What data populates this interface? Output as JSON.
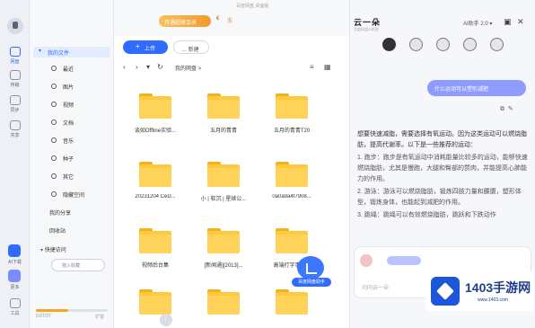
{
  "rail": {
    "items": [
      {
        "label": "网盘"
      },
      {
        "label": "传输"
      },
      {
        "label": "同步"
      },
      {
        "label": "共享"
      }
    ],
    "bottom": [
      {
        "label": "AI下载"
      },
      {
        "label": "更多"
      },
      {
        "label": "工具"
      }
    ]
  },
  "nav": {
    "header": "我的文件",
    "items": [
      {
        "label": "最近",
        "icon": "clock-icon"
      },
      {
        "label": "图片",
        "icon": "image-icon"
      },
      {
        "label": "视频",
        "icon": "play-icon"
      },
      {
        "label": "文档",
        "icon": "doc-icon"
      },
      {
        "label": "音乐",
        "icon": "headphones-icon"
      },
      {
        "label": "种子",
        "icon": "bt-icon"
      },
      {
        "label": "其它",
        "icon": "more-icon"
      },
      {
        "label": "隐藏空间",
        "icon": "lock-icon"
      }
    ],
    "share": "我的分享",
    "recycle": "回收站",
    "quick": "快捷访问",
    "user_placeholder": "拖入收藏",
    "storage": {
      "text": "0.6T/2T",
      "sub": "扩容",
      "used_fraction": 0.45
    }
  },
  "topbar": {
    "vip": "开通超级会员",
    "mini1": "€",
    "mini2": "Ⓢ",
    "dim": "百度网盘 桌面版"
  },
  "toolbar": {
    "upload": "上传",
    "new": "… 新建"
  },
  "path": {
    "crumb": "我的网盘 >"
  },
  "files": [
    {
      "name": "谈如Offline实验..."
    },
    {
      "name": "五月的青青"
    },
    {
      "name": "五月的青青T20"
    },
    {
      "name": "20231204 CeD..."
    },
    {
      "name": "小 | 软沉 | 星续公..."
    },
    {
      "name": "0a0a9a4f7908..."
    },
    {
      "name": "视频后台集"
    },
    {
      "name": "[新闻通][2013]..."
    },
    {
      "name": "高端打字事件..."
    },
    {
      "name": ""
    },
    {
      "name": ""
    },
    {
      "name": ""
    }
  ],
  "float_cloud": {
    "label": "百度网盘助手"
  },
  "ai": {
    "brand": "云一朵",
    "sub": "百度网盘AI助理",
    "user": "AI助手 2.0",
    "avatars": [
      "",
      "",
      "",
      "",
      ""
    ],
    "question": "什么运动可以塑形减肥",
    "answer": [
      "想要快速减脂，需要选择有氧运动。因为这类运动可以燃烧脂肪，提高代谢率。以下是一些推荐的运动：",
      "1. 跑步：跑步是有氧运动中消耗能量比较多的运动，能够快速燃烧脂肪，尤其是慢跑，大腿和臀部的赘肉，并能提高心肺能力的作用。",
      "2. 游泳：游泳可以燃烧脂肪，锻炼四肢力量和腰腹，塑形体型，锻炼身体，也能起到减肥的作用。",
      "3. 跳绳：跳绳可以有效燃烧脂肪，跳跃和下跌动作"
    ],
    "composer_placeholder": "问问云一朵"
  },
  "watermark": {
    "title": "1403手游网",
    "sub": "www.1403.com"
  }
}
